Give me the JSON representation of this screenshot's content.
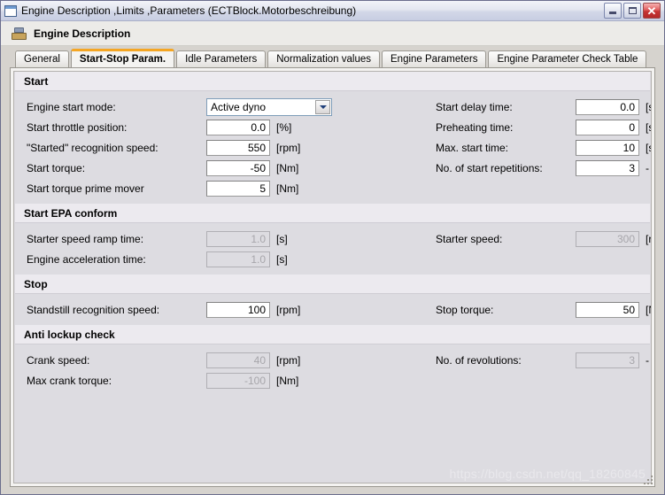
{
  "window": {
    "title": "Engine Description ,Limits ,Parameters  (ECTBlock.Motorbeschreibung)",
    "icon": "window-icon",
    "buttons": {
      "minimize": "_",
      "maximize": "❐",
      "close": "✕"
    }
  },
  "header": {
    "icon": "engine-icon",
    "title": "Engine Description"
  },
  "tabs": [
    {
      "label": "General",
      "active": false
    },
    {
      "label": "Start-Stop Param.",
      "active": true
    },
    {
      "label": "Idle Parameters",
      "active": false
    },
    {
      "label": "Normalization values",
      "active": false
    },
    {
      "label": "Engine Parameters",
      "active": false
    },
    {
      "label": "Engine Parameter Check Table",
      "active": false
    }
  ],
  "sections": [
    {
      "title": "Start",
      "rows": [
        {
          "left": {
            "label": "Engine start mode:",
            "type": "combo",
            "value": "Active dyno",
            "unit": "",
            "disabled": false
          },
          "right": {
            "label": "Start delay time:",
            "type": "text",
            "value": "0.0",
            "unit": "[s]",
            "disabled": false
          }
        },
        {
          "left": {
            "label": "Start throttle position:",
            "type": "text",
            "value": "0.0",
            "unit": "[%]",
            "disabled": false
          },
          "right": {
            "label": "Preheating time:",
            "type": "text",
            "value": "0",
            "unit": "[s]",
            "disabled": false
          }
        },
        {
          "left": {
            "label": "\"Started\" recognition speed:",
            "type": "text",
            "value": "550",
            "unit": "[rpm]",
            "disabled": false
          },
          "right": {
            "label": "Max. start time:",
            "type": "text",
            "value": "10",
            "unit": "[s]",
            "disabled": false
          }
        },
        {
          "left": {
            "label": "Start torque:",
            "type": "text",
            "value": "-50",
            "unit": "[Nm]",
            "disabled": false
          },
          "right": {
            "label": "No. of start repetitions:",
            "type": "text",
            "value": "3",
            "unit": "-",
            "disabled": false
          }
        },
        {
          "left": {
            "label": "Start torque prime mover",
            "type": "text",
            "value": "5",
            "unit": "[Nm]",
            "disabled": false
          },
          "right": null
        }
      ]
    },
    {
      "title": "Start EPA conform",
      "rows": [
        {
          "left": {
            "label": "Starter speed ramp time:",
            "type": "text",
            "value": "1.0",
            "unit": "[s]",
            "disabled": true
          },
          "right": {
            "label": "Starter speed:",
            "type": "text",
            "value": "300",
            "unit": "[rpm]",
            "disabled": true
          }
        },
        {
          "left": {
            "label": "Engine acceleration time:",
            "type": "text",
            "value": "1.0",
            "unit": "[s]",
            "disabled": true
          },
          "right": null
        }
      ]
    },
    {
      "title": "Stop",
      "rows": [
        {
          "left": {
            "label": "Standstill recognition speed:",
            "type": "text",
            "value": "100",
            "unit": "[rpm]",
            "disabled": false
          },
          "right": {
            "label": "Stop torque:",
            "type": "text",
            "value": "50",
            "unit": "[Nm]",
            "disabled": false
          }
        }
      ]
    },
    {
      "title": "Anti lockup check",
      "rows": [
        {
          "left": {
            "label": "Crank speed:",
            "type": "text",
            "value": "40",
            "unit": "[rpm]",
            "disabled": true
          },
          "right": {
            "label": "No. of revolutions:",
            "type": "text",
            "value": "3",
            "unit": "-",
            "disabled": true
          }
        },
        {
          "left": {
            "label": "Max crank torque:",
            "type": "text",
            "value": "-100",
            "unit": "[Nm]",
            "disabled": true
          },
          "right": null
        }
      ]
    }
  ],
  "watermark": "https://blog.csdn.net/qq_18260845",
  "colors": {
    "active_tab_accent": "#f5a623",
    "panel_bg": "#dddce1",
    "section_header_bg": "#eceaef",
    "close_button": "#c53434"
  }
}
